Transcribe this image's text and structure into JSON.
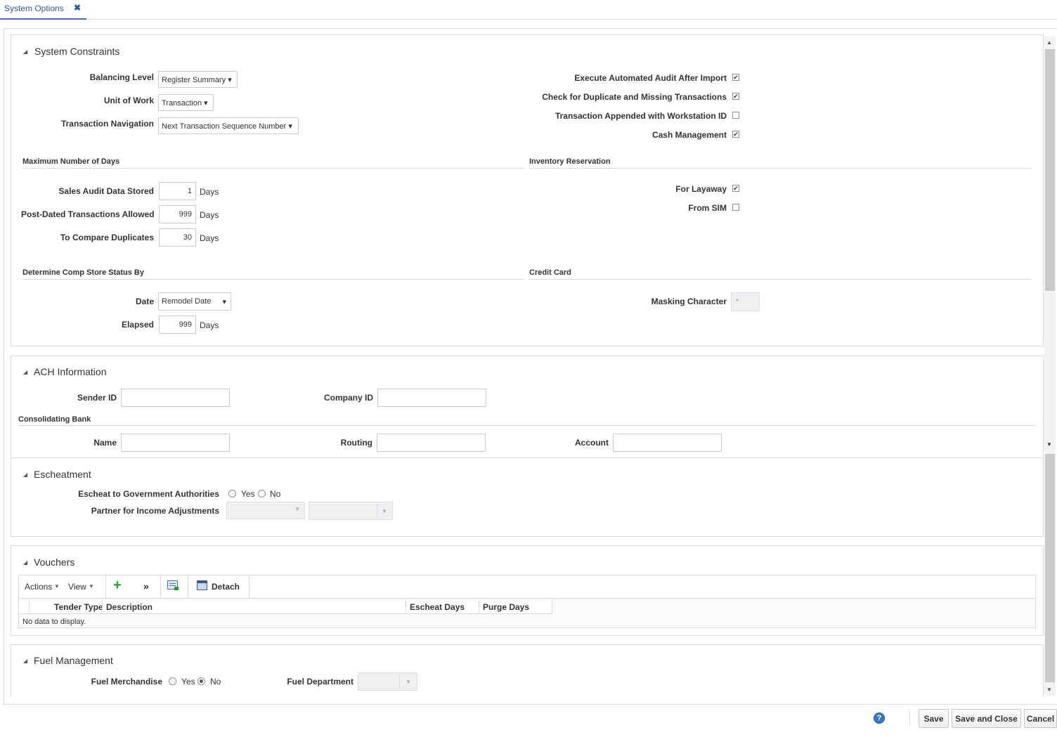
{
  "tab": {
    "label": "System Options",
    "close": "✖"
  },
  "system_constraints": {
    "title": "System Constraints",
    "balancing_level": {
      "label": "Balancing Level",
      "value": "Register Summary ▾"
    },
    "unit_of_work": {
      "label": "Unit of Work",
      "value": "Transaction ▾"
    },
    "transaction_navigation": {
      "label": "Transaction Navigation",
      "value": "Next Transaction Sequence Number ▾"
    },
    "checks": [
      {
        "label": "Execute Automated Audit After Import",
        "checked": true
      },
      {
        "label": "Check for Duplicate and Missing Transactions",
        "checked": true
      },
      {
        "label": "Transaction Appended with Workstation ID",
        "checked": false
      },
      {
        "label": "Cash Management",
        "checked": true
      }
    ],
    "max_days": {
      "title": "Maximum Number of Days",
      "unit": "Days",
      "sales_audit": {
        "label": "Sales Audit Data Stored",
        "value": "1"
      },
      "post_dated": {
        "label": "Post-Dated Transactions Allowed",
        "value": "999"
      },
      "compare_dupes": {
        "label": "To Compare Duplicates",
        "value": "30"
      }
    },
    "inventory_reservation": {
      "title": "Inventory Reservation",
      "for_layaway": {
        "label": "For Layaway",
        "checked": true
      },
      "from_sim": {
        "label": "From SIM",
        "checked": false
      }
    },
    "comp_store": {
      "title": "Determine Comp Store Status By",
      "date": {
        "label": "Date",
        "value": "Remodel Date",
        "arrow": "▾"
      },
      "elapsed": {
        "label": "Elapsed",
        "value": "999",
        "unit": "Days"
      }
    },
    "credit_card": {
      "title": "Credit Card",
      "masking": {
        "label": "Masking Character",
        "value": "*"
      }
    }
  },
  "ach": {
    "title": "ACH Information",
    "sender_id": {
      "label": "Sender ID",
      "value": ""
    },
    "company_id": {
      "label": "Company ID",
      "value": ""
    },
    "consolidating_bank": "Consolidating Bank",
    "name": {
      "label": "Name",
      "value": ""
    },
    "routing": {
      "label": "Routing",
      "value": ""
    },
    "account": {
      "label": "Account",
      "value": ""
    }
  },
  "escheatment": {
    "title": "Escheatment",
    "escheat_label": "Escheat to Government Authorities",
    "yes": "Yes",
    "no": "No",
    "partner_label": "Partner for Income Adjustments"
  },
  "vouchers": {
    "title": "Vouchers",
    "actions": "Actions",
    "view": "View",
    "more": "»",
    "detach": "Detach",
    "columns": [
      "Tender Type",
      "Description",
      "Escheat Days",
      "Purge Days"
    ],
    "empty": "No data to display."
  },
  "fuel": {
    "title": "Fuel Management",
    "merch_label": "Fuel Merchandise",
    "yes": "Yes",
    "no": "No",
    "selected": "No",
    "dept_label": "Fuel Department"
  },
  "footer": {
    "help": "?",
    "save": "Save",
    "save_close": "Save and Close",
    "cancel": "Cancel"
  }
}
